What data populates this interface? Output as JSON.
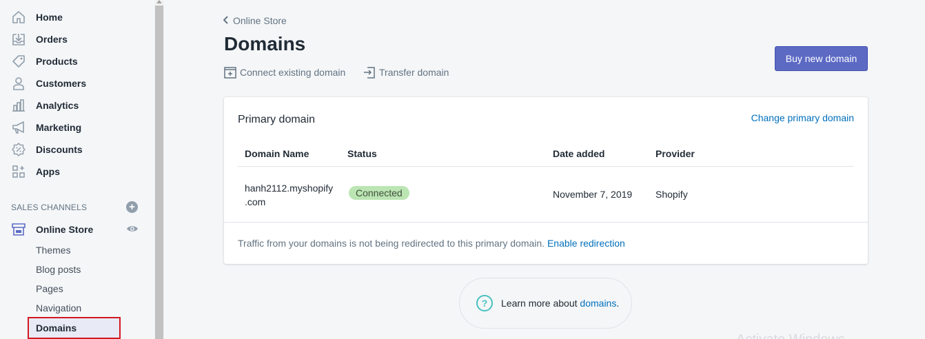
{
  "sidebar": {
    "items": [
      {
        "label": "Home",
        "icon": "home-icon"
      },
      {
        "label": "Orders",
        "icon": "orders-icon"
      },
      {
        "label": "Products",
        "icon": "tag-icon"
      },
      {
        "label": "Customers",
        "icon": "person-icon"
      },
      {
        "label": "Analytics",
        "icon": "bar-chart-icon"
      },
      {
        "label": "Marketing",
        "icon": "megaphone-icon"
      },
      {
        "label": "Discounts",
        "icon": "discount-icon"
      },
      {
        "label": "Apps",
        "icon": "apps-icon"
      }
    ],
    "sales_channels_header": "SALES CHANNELS",
    "online_store": "Online Store",
    "sub_items": [
      "Themes",
      "Blog posts",
      "Pages",
      "Navigation"
    ],
    "active_sub_item": "Domains"
  },
  "breadcrumb": "Online Store",
  "page_title": "Domains",
  "actions": {
    "connect": "Connect existing domain",
    "transfer": "Transfer domain",
    "buy": "Buy new domain"
  },
  "card": {
    "title": "Primary domain",
    "change_link": "Change primary domain",
    "columns": [
      "Domain Name",
      "Status",
      "Date added",
      "Provider"
    ],
    "row": {
      "domain_line1": "hanh2112.myshopify",
      "domain_line2": ".com",
      "status": "Connected",
      "date_added": "November 7, 2019",
      "provider": "Shopify"
    },
    "footer_text": "Traffic from your domains is not being redirected to this primary domain.",
    "footer_link": "Enable redirection"
  },
  "learn_more": {
    "prefix": "Learn more about",
    "link": "domains",
    "suffix": "."
  },
  "watermark": "Activate Windows",
  "colors": {
    "accent": "#5c6ac4",
    "link": "#006fbb",
    "badge_green": "#bbe5b3",
    "highlight_border": "#d2181f"
  }
}
